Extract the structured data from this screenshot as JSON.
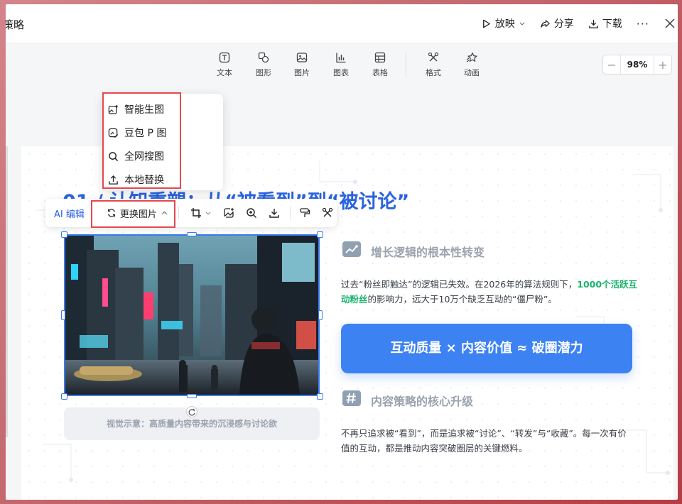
{
  "window": {
    "title": "策略",
    "actions": {
      "present_label": "放映",
      "share_label": "分享",
      "download_label": "下载",
      "more_label": "···"
    }
  },
  "toolbar": {
    "tools": [
      {
        "label": "文本",
        "icon": "text-icon"
      },
      {
        "label": "图形",
        "icon": "shape-icon"
      },
      {
        "label": "图片",
        "icon": "image-icon"
      },
      {
        "label": "图表",
        "icon": "chart-icon"
      },
      {
        "label": "表格",
        "icon": "table-icon"
      },
      {
        "label": "格式",
        "icon": "format-icon"
      },
      {
        "label": "动画",
        "icon": "animation-icon"
      }
    ],
    "zoom": {
      "minus": "−",
      "value": "98%",
      "plus": "+"
    }
  },
  "image_toolbar": {
    "ai_edit_label": "AI 编辑",
    "replace_label": "更换图片"
  },
  "replace_menu": {
    "items": [
      {
        "label": "智能生图",
        "icon": "ai-image-icon"
      },
      {
        "label": "豆包 P 图",
        "icon": "doubao-edit-icon"
      },
      {
        "label": "全网搜图",
        "icon": "search-icon"
      },
      {
        "label": "本地替换",
        "icon": "upload-icon"
      }
    ]
  },
  "slide": {
    "title": "01 / 认知重塑：从“被看到”到“被讨论”",
    "image_caption": "视觉示意：高质量内容带来的沉浸感与讨论欲",
    "section1": {
      "heading": "增长逻辑的根本性转变",
      "text_before": "过去“粉丝即触达”的逻辑已失效。在2026年的算法规则下，",
      "text_highlight": "1000个活跃互动粉丝",
      "text_after": "的影响力，远大于10万个缺乏互动的“僵尸粉”。"
    },
    "banner": "互动质量 × 内容价值 ≈ 破圈潜力",
    "section2": {
      "heading": "内容策略的核心升级",
      "text": "不再只追求被“看到”，而是追求被“讨论”、“转发”与“收藏”。每一次有价值的互动，都是推动内容突破圈层的关键燃料。"
    }
  },
  "colors": {
    "accent": "#2a63e0",
    "banner": "#3d82f2",
    "highlight": "#19b36b",
    "annotation": "#e5484d"
  }
}
